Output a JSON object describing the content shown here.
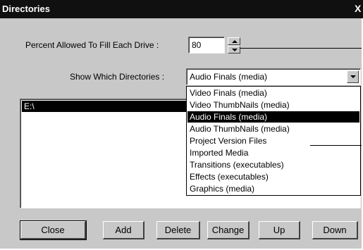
{
  "window": {
    "title": "Directories",
    "close_glyph": "X"
  },
  "percent": {
    "label": "Percent Allowed To Fill Each Drive :",
    "value": "80"
  },
  "show_dirs": {
    "label": "Show Which Directories :",
    "selected": "Audio Finals (media)",
    "options": [
      "Video Finals (media)",
      "Video ThumbNails (media)",
      "Audio Finals (media)",
      "Audio ThumbNails (media)",
      "Project Version Files",
      "Imported Media",
      "Transitions (executables)",
      "Effects (executables)",
      "Graphics (media)"
    ],
    "highlighted_index": 2
  },
  "directory_list": {
    "items": [
      "E:\\"
    ]
  },
  "buttons": {
    "close": "Close",
    "add": "Add",
    "delete": "Delete",
    "change": "Change",
    "up": "Up",
    "down": "Down"
  }
}
